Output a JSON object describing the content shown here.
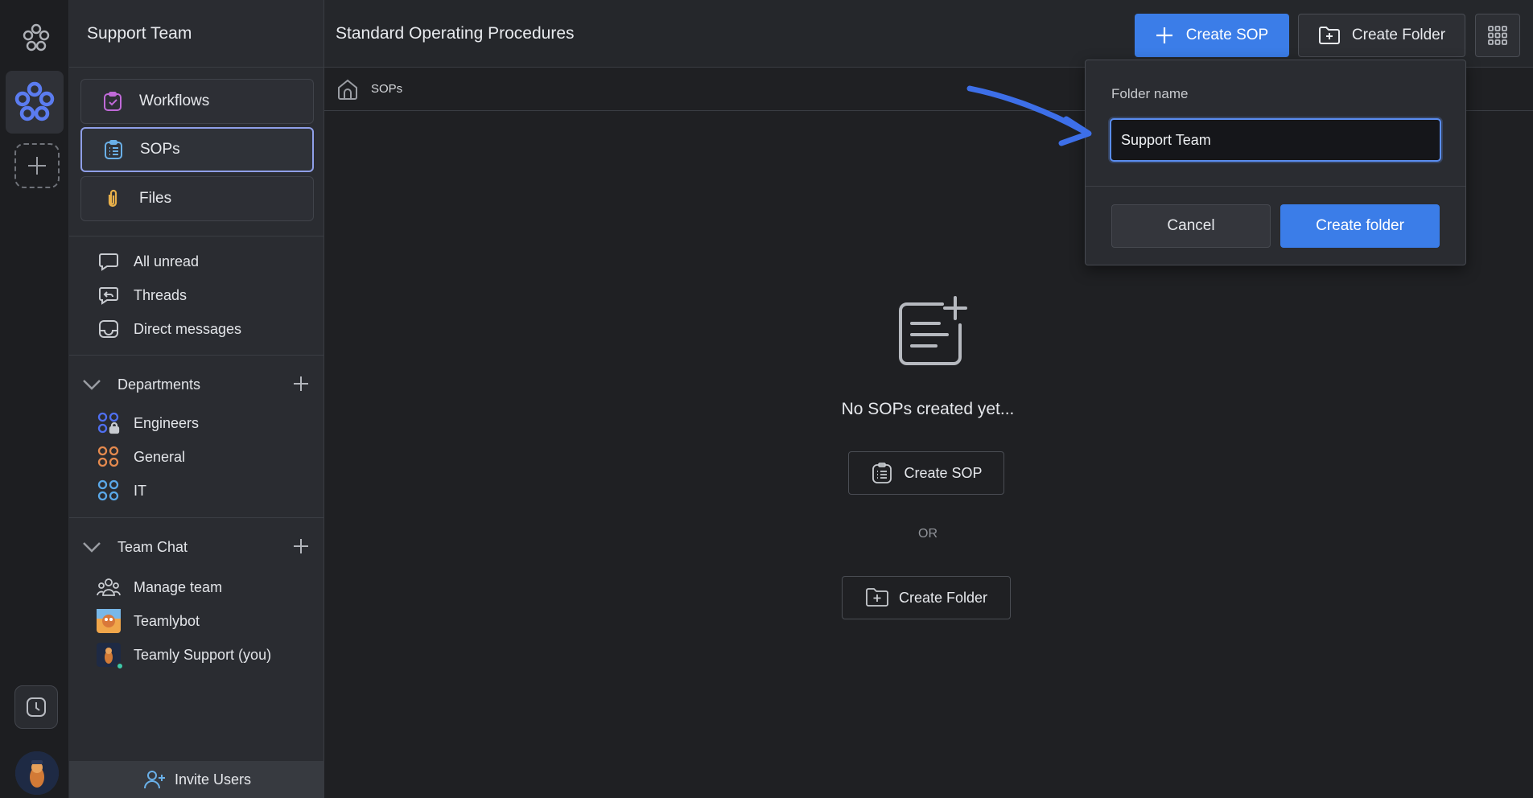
{
  "workspace": {
    "name": "Support Team"
  },
  "nav": {
    "cards": [
      {
        "label": "Workflows",
        "icon": "clipboard-check-icon"
      },
      {
        "label": "SOPs",
        "icon": "clipboard-list-icon"
      },
      {
        "label": "Files",
        "icon": "paperclip-icon"
      }
    ],
    "inbox": [
      {
        "label": "All unread",
        "icon": "chat-bubble-icon"
      },
      {
        "label": "Threads",
        "icon": "threads-icon"
      },
      {
        "label": "Direct messages",
        "icon": "inbox-icon"
      }
    ]
  },
  "departments": {
    "title": "Departments",
    "items": [
      {
        "label": "Engineers",
        "icon": "locked-group-icon",
        "color": "#4f6ff0"
      },
      {
        "label": "General",
        "icon": "group-icon",
        "color": "#e58a4e"
      },
      {
        "label": "IT",
        "icon": "group-icon",
        "color": "#5aa8e8"
      }
    ]
  },
  "team_chat": {
    "title": "Team Chat",
    "items": [
      {
        "label": "Manage team",
        "icon": "team-icon"
      },
      {
        "label": "Teamlybot",
        "icon": "bot-avatar"
      },
      {
        "label": "Teamly Support (you)",
        "icon": "user-avatar"
      }
    ]
  },
  "invite": {
    "label": "Invite Users"
  },
  "header": {
    "title": "Standard Operating Procedures",
    "create_sop": "Create SOP",
    "create_folder": "Create Folder"
  },
  "breadcrumb": {
    "current": "SOPs"
  },
  "empty_state": {
    "message": "No SOPs created yet...",
    "create_sop": "Create SOP",
    "or": "OR",
    "create_folder": "Create Folder"
  },
  "popover": {
    "label": "Folder name",
    "value": "Support Team",
    "cancel": "Cancel",
    "submit": "Create folder"
  },
  "colors": {
    "accent": "#3b7de8",
    "background": "#1f2023",
    "sidebar": "#2a2c31"
  }
}
